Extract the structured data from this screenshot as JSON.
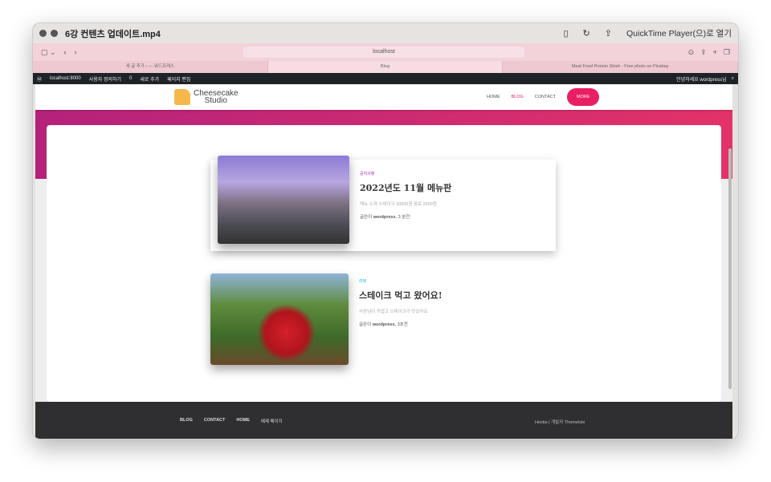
{
  "window": {
    "title": "6강 컨텐츠 업데이트.mp4",
    "open_with": "QuickTime Player(으)로 열기"
  },
  "browser": {
    "url": "localhost",
    "tabs": [
      "새 글 추가 ‹ — 워드프레스",
      "Blog",
      "Meat Food Protein Shish - Free photo on Pixabay"
    ]
  },
  "wpbar": {
    "site": "localhost:8000",
    "customize": "사용자 정의하기",
    "comments": "0",
    "new": "새로 추가",
    "edit": "페이지 편집",
    "greeting": "안녕하세요 wordpress님"
  },
  "header": {
    "logo_line1": "Cheesecake",
    "logo_line2": "Studio",
    "nav": [
      "HOME",
      "BLOG",
      "CONTACT"
    ],
    "more": "MORE"
  },
  "posts": [
    {
      "category": "공지사항",
      "category_color": "#9c27b0",
      "title": "2022년도 11월 메뉴판",
      "excerpt": "메뉴 소개 스테이크 30000원 음료 2000원",
      "by": "글쓴이",
      "author": "wordpress",
      "time": ", 3 분전"
    },
    {
      "category": "리뷰",
      "category_color": "#03a9f4",
      "title": "스테이크 먹고 왔어요!",
      "excerpt": "사장님이 귀엽고 스테이크가 맛있어요",
      "by": "글쓴이",
      "author": "wordpress",
      "time": ", 3초전"
    }
  ],
  "footer": {
    "nav": [
      "BLOG",
      "CONTACT",
      "HOME",
      "예제 페이지"
    ],
    "credit": "Hestia | 개발자 ThemeIsle"
  }
}
